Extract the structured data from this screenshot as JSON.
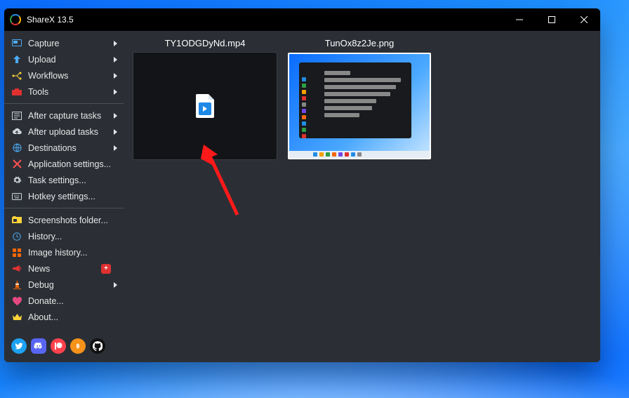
{
  "window": {
    "title": "ShareX 13.5"
  },
  "sidebar": {
    "groups": [
      [
        {
          "id": "capture",
          "icon": "screen-select-icon",
          "color": "#4dabf7",
          "label": "Capture",
          "submenu": true
        },
        {
          "id": "upload",
          "icon": "upload-arrow-icon",
          "color": "#4dabf7",
          "label": "Upload",
          "submenu": true
        },
        {
          "id": "workflows",
          "icon": "branch-icon",
          "color": "#ffd43b",
          "label": "Workflows",
          "submenu": true
        },
        {
          "id": "tools",
          "icon": "toolbox-icon",
          "color": "#e03131",
          "label": "Tools",
          "submenu": true
        }
      ],
      [
        {
          "id": "after-capture",
          "icon": "list-check-icon",
          "color": "#ced4da",
          "label": "After capture tasks",
          "submenu": true
        },
        {
          "id": "after-upload",
          "icon": "cloud-up-icon",
          "color": "#ced4da",
          "label": "After upload tasks",
          "submenu": true
        },
        {
          "id": "destinations",
          "icon": "globe-pin-icon",
          "color": "#4dabf7",
          "label": "Destinations",
          "submenu": true
        },
        {
          "id": "app-settings",
          "icon": "crossed-tools-icon",
          "color": "#fa5252",
          "label": "Application settings..."
        },
        {
          "id": "task-settings",
          "icon": "gear-icon",
          "color": "#ced4da",
          "label": "Task settings..."
        },
        {
          "id": "hotkeys",
          "icon": "keyboard-icon",
          "color": "#ced4da",
          "label": "Hotkey settings..."
        }
      ],
      [
        {
          "id": "screenshots-folder",
          "icon": "folder-image-icon",
          "color": "#ffd43b",
          "label": "Screenshots folder..."
        },
        {
          "id": "history",
          "icon": "clock-icon",
          "color": "#4dabf7",
          "label": "History..."
        },
        {
          "id": "image-history",
          "icon": "grid-icon",
          "color": "#f76707",
          "label": "Image history..."
        },
        {
          "id": "news",
          "icon": "megaphone-icon",
          "color": "#e03131",
          "label": "News",
          "badge": "+"
        },
        {
          "id": "debug",
          "icon": "traffic-cone-icon",
          "color": "#f76707",
          "label": "Debug",
          "submenu": true
        },
        {
          "id": "donate",
          "icon": "heart-icon",
          "color": "#e64980",
          "label": "Donate..."
        },
        {
          "id": "about",
          "icon": "crown-icon",
          "color": "#ffd43b",
          "label": "About..."
        }
      ]
    ]
  },
  "social": [
    {
      "id": "twitter",
      "name": "twitter-icon"
    },
    {
      "id": "discord",
      "name": "discord-icon"
    },
    {
      "id": "patreon",
      "name": "patreon-icon"
    },
    {
      "id": "bitcoin",
      "name": "bitcoin-icon"
    },
    {
      "id": "github",
      "name": "github-icon"
    }
  ],
  "files": [
    {
      "name": "TY1ODGDyNd.mp4",
      "kind": "video",
      "selected": true
    },
    {
      "name": "TunOx8z2Je.png",
      "kind": "screenshot",
      "selected": false
    }
  ]
}
